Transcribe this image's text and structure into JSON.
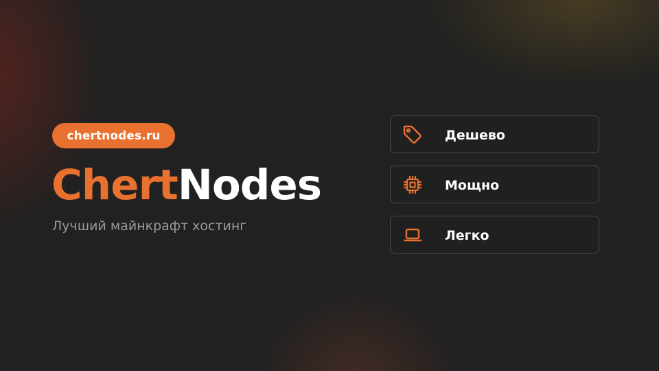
{
  "badge": {
    "text": "chertnodes.ru"
  },
  "title": {
    "part1": "Chert",
    "part2": "Nodes"
  },
  "subtitle": "Лучший майнкрафт хостинг",
  "features": [
    {
      "label": "Дешево",
      "icon": "tag-icon"
    },
    {
      "label": "Мощно",
      "icon": "cpu-chip-icon"
    },
    {
      "label": "Легко",
      "icon": "laptop-icon"
    }
  ],
  "colors": {
    "accent": "#e8712f",
    "background": "#212121",
    "text": "#ffffff",
    "muted": "#9a9a9a",
    "border": "#4a4a4a"
  }
}
